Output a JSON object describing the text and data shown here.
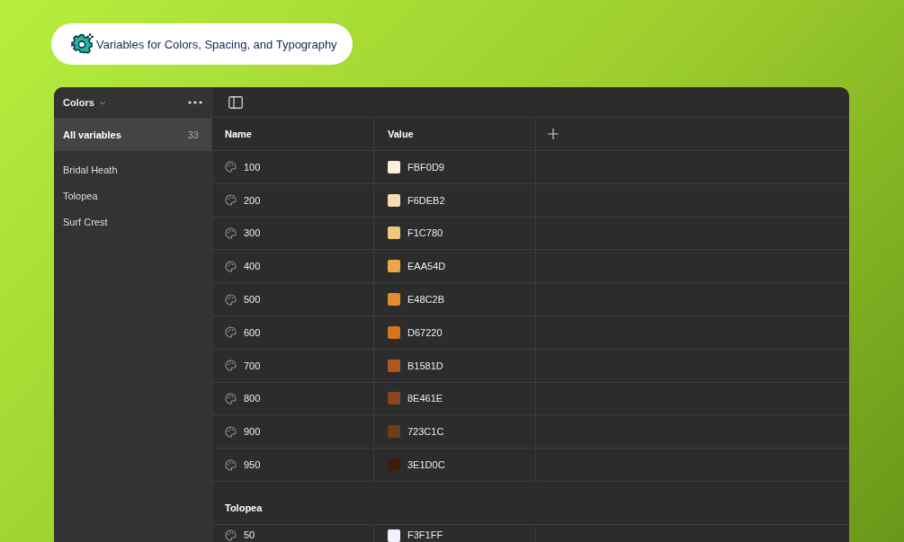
{
  "badge": {
    "text": "Variables for Colors, Spacing, and Typography"
  },
  "sidebar": {
    "collection": "Colors",
    "items": [
      {
        "label": "All variables",
        "count": "33",
        "selected": true
      },
      {
        "label": "Bridal Heath",
        "selected": false
      },
      {
        "label": "Tolopea",
        "selected": false
      },
      {
        "label": "Surf Crest",
        "selected": false
      }
    ]
  },
  "table": {
    "columns": [
      "Name",
      "Value"
    ],
    "groups": [
      {
        "rows": [
          {
            "name": "100",
            "value": "FBF0D9",
            "color": "#fbf0d9"
          },
          {
            "name": "200",
            "value": "F6DEB2",
            "color": "#f6deb2"
          },
          {
            "name": "300",
            "value": "F1C780",
            "color": "#f1c780"
          },
          {
            "name": "400",
            "value": "EAA54D",
            "color": "#eaa54d"
          },
          {
            "name": "500",
            "value": "E48C2B",
            "color": "#e48c2b"
          },
          {
            "name": "600",
            "value": "D67220",
            "color": "#d67220"
          },
          {
            "name": "700",
            "value": "B1581D",
            "color": "#b1581d"
          },
          {
            "name": "800",
            "value": "8E461E",
            "color": "#8e461e"
          },
          {
            "name": "900",
            "value": "723C1C",
            "color": "#723c1c"
          },
          {
            "name": "950",
            "value": "3E1D0C",
            "color": "#3e1d0c"
          }
        ]
      },
      {
        "title": "Tolopea",
        "rows": [
          {
            "name": "50",
            "value": "F3F1FF",
            "color": "#f3f1ff"
          }
        ]
      }
    ]
  }
}
